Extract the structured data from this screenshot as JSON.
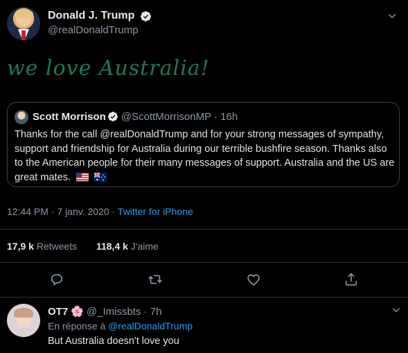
{
  "tweet": {
    "author_name": "Donald J. Trump",
    "author_handle": "@realDonaldTrump",
    "text": "we love Australia!",
    "time": "12:44 PM",
    "date": "7 janv. 2020",
    "separator": "·",
    "source": "Twitter for iPhone"
  },
  "quote": {
    "author_name": "Scott Morrison",
    "author_handle": "@ScottMorrisonMP",
    "separator": "·",
    "age": "16h",
    "text": "Thanks for the call @realDonaldTrump and for your strong messages of sympathy, support and friendship for Australia during our terrible bushfire season. Thanks also to the American people for their many messages of support. Australia and the US are great mates."
  },
  "stats": {
    "retweets_count": "17,9 k",
    "retweets_label": "Retweets",
    "likes_count": "118,4 k",
    "likes_label": "J'aime"
  },
  "reply": {
    "author_name": "OT7",
    "emoji": "🌸",
    "author_handle": "@_Imissbts",
    "separator": "·",
    "age": "7h",
    "replying_prefix": "En réponse à",
    "replying_to": "@realDonaldTrump",
    "text": "But Australia doesn't love you"
  },
  "colors": {
    "background": "#000000",
    "handwriting": "#1a7a5c",
    "link": "#1da1f2",
    "verified": "#e7e9ea"
  },
  "icons": [
    "verified-badge-icon",
    "chevron-down-icon",
    "reply-icon",
    "retweet-icon",
    "like-icon",
    "share-icon",
    "us-flag-icon",
    "au-flag-icon"
  ]
}
